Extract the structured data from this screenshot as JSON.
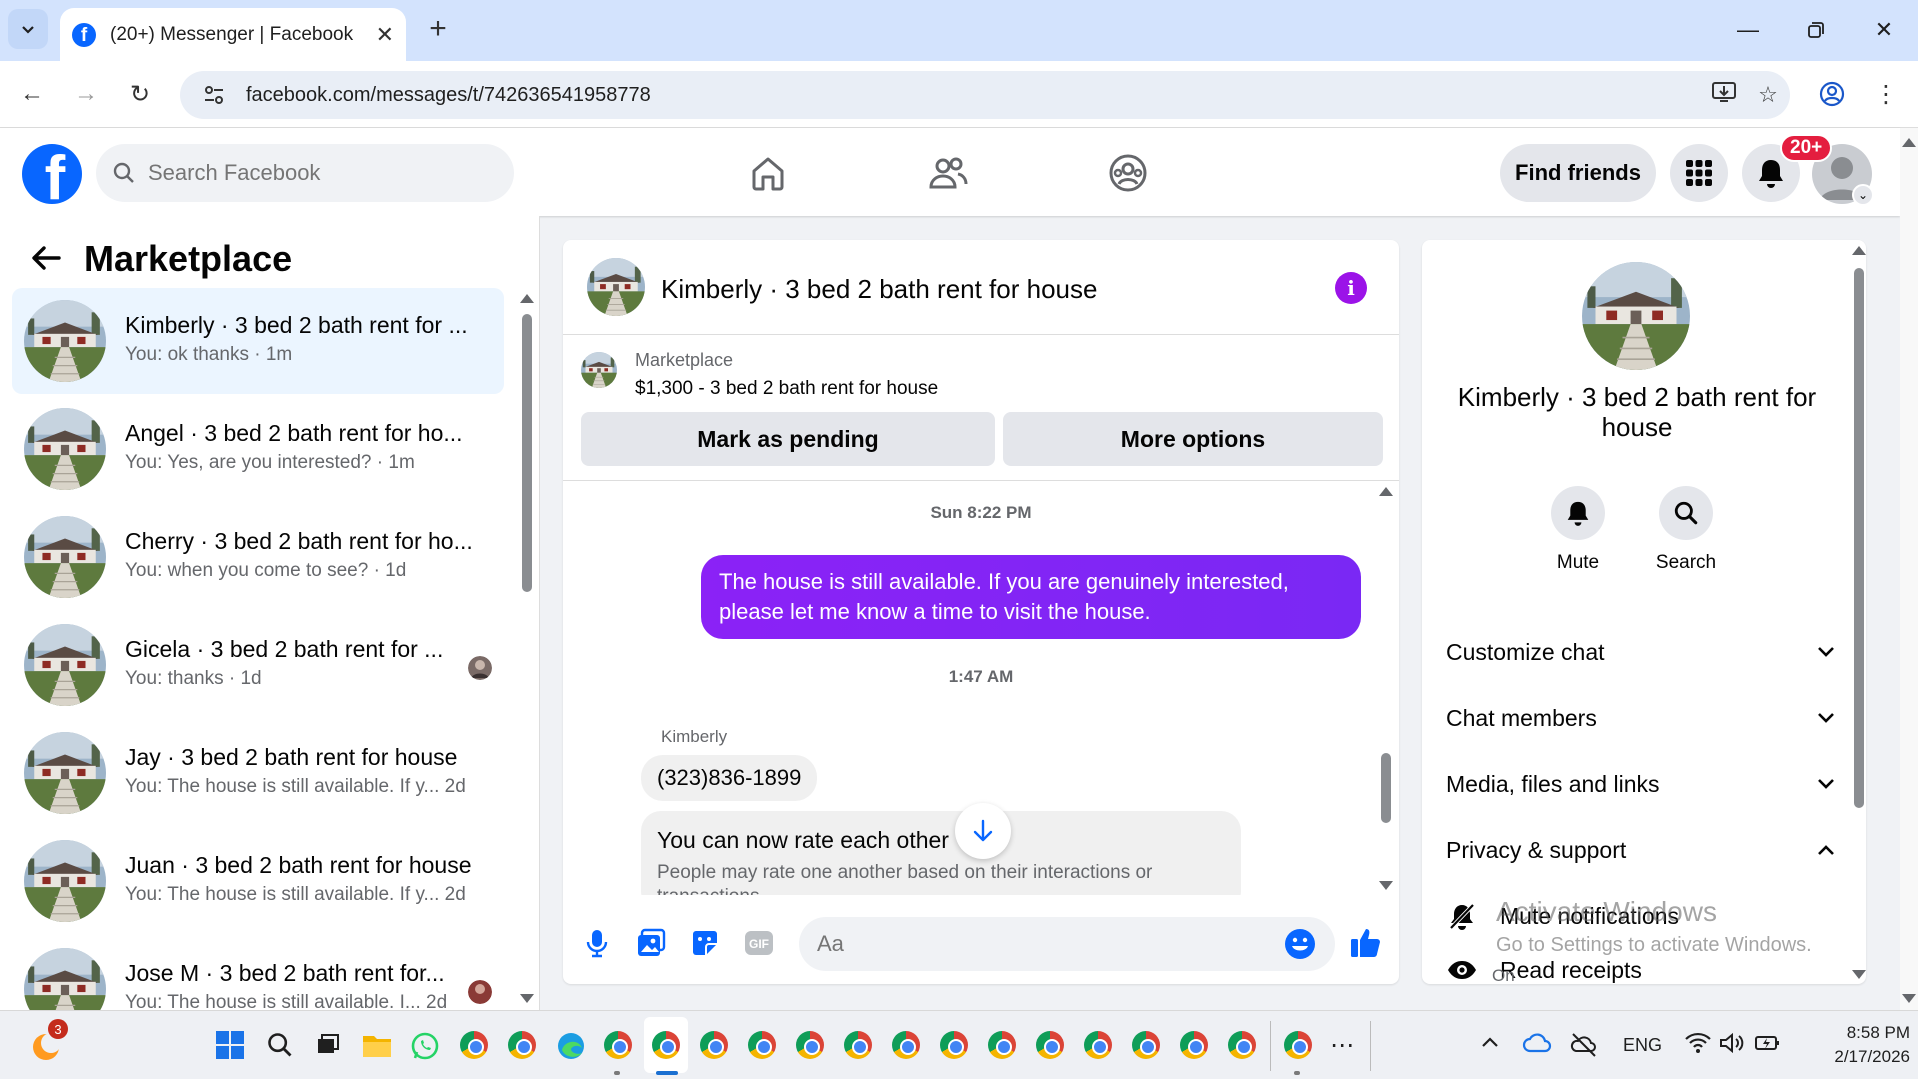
{
  "browser": {
    "tab_title": "(20+) Messenger | Facebook",
    "url": "facebook.com/messages/t/742636541958778"
  },
  "fb_header": {
    "search_placeholder": "Search Facebook",
    "find_friends": "Find friends",
    "notification_count": "20+"
  },
  "chat_list": {
    "title": "Marketplace",
    "items": [
      {
        "name": "Kimberly · 3 bed 2 bath rent for ...",
        "preview": "You: ok thanks · 1m",
        "active": true
      },
      {
        "name": "Angel · 3 bed 2 bath rent for ho...",
        "preview": "You: Yes, are you interested? · 1m",
        "active": false
      },
      {
        "name": "Cherry · 3 bed 2 bath rent for ho...",
        "preview": "You: when you come to see? · 1d",
        "active": false
      },
      {
        "name": "Gicela · 3 bed 2 bath rent for ...",
        "preview": "You: thanks · 1d",
        "active": false
      },
      {
        "name": "Jay · 3 bed 2 bath rent for house",
        "preview": "You: The house is still available. If y...   2d",
        "active": false
      },
      {
        "name": "Juan · 3 bed 2 bath rent for house",
        "preview": "You: The house is still available. If y...   2d",
        "active": false
      },
      {
        "name": "Jose M · 3 bed 2 bath rent for...",
        "preview": "You: The house is still available. I...   2d",
        "active": false
      }
    ]
  },
  "conversation": {
    "title": "Kimberly · 3 bed 2 bath rent for house",
    "marketplace_label": "Marketplace",
    "listing": "$1,300 - 3 bed 2 bath rent for house",
    "mark_pending": "Mark as pending",
    "more_options": "More options",
    "timestamp_1": "Sun 8:22 PM",
    "outgoing_message": "The house is still available. If you are genuinely interested, please let me know a time to visit the house.",
    "timestamp_2": "1:47 AM",
    "sender_name": "Kimberly",
    "incoming_message": "(323)836-1899",
    "rate_title": "You can now rate each other",
    "rate_description": "People may rate one another based on their interactions or transactions",
    "input_placeholder": "Aa"
  },
  "info_panel": {
    "name": "Kimberly · 3 bed 2 bath rent for house",
    "mute_label": "Mute",
    "search_label": "Search",
    "sections": {
      "customize": "Customize chat",
      "members": "Chat members",
      "media": "Media, files and links",
      "privacy": "Privacy & support"
    },
    "mute_notifications": "Mute notifications",
    "read_receipts": "Read receipts",
    "read_receipts_state": "On"
  },
  "watermark": {
    "title": "Activate Windows",
    "subtitle": "Go to Settings to activate Windows."
  },
  "taskbar": {
    "language": "ENG",
    "time": "8:58 PM",
    "date": "2/17/2026",
    "widget_badge": "3"
  },
  "colors": {
    "fb_blue": "#0866ff",
    "messenger_purple": "#8b22f6",
    "badge_red": "#e41e3f"
  }
}
